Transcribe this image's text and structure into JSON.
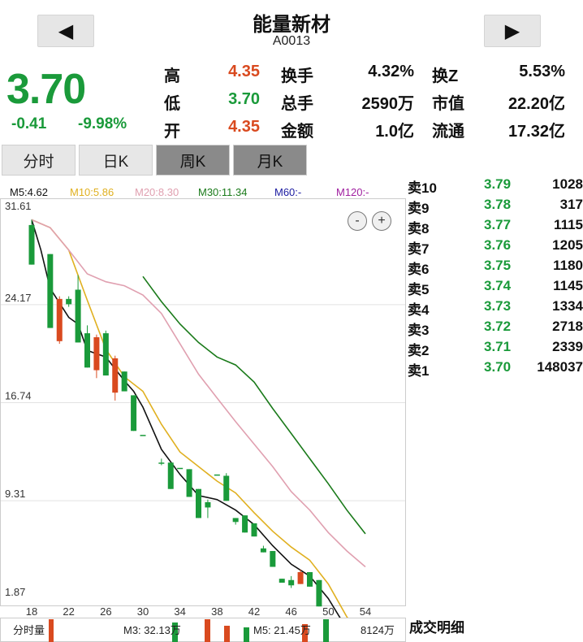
{
  "header": {
    "prev_icon": "left-triangle-icon",
    "next_icon": "right-triangle-icon",
    "name": "能量新材",
    "code": "A0013"
  },
  "quote": {
    "price": "3.70",
    "change": "-0.41",
    "change_pct": "-9.98%",
    "stats": [
      {
        "label": "高",
        "value": "4.35",
        "color": "#d94a1f"
      },
      {
        "label": "低",
        "value": "3.70",
        "color": "#1a9a3a"
      },
      {
        "label": "开",
        "value": "4.35",
        "color": "#d94a1f"
      },
      {
        "label": "换手",
        "value": "4.32%",
        "color": "#111111"
      },
      {
        "label": "总手",
        "value": "2590万",
        "color": "#111111"
      },
      {
        "label": "金额",
        "value": "1.0亿",
        "color": "#111111"
      },
      {
        "label": "换Z",
        "value": "5.53%",
        "color": "#111111"
      },
      {
        "label": "市值",
        "value": "22.20亿",
        "color": "#111111"
      },
      {
        "label": "流通",
        "value": "17.32亿",
        "color": "#111111"
      }
    ]
  },
  "tabs": [
    {
      "label": "分时",
      "style": "light"
    },
    {
      "label": "日K",
      "style": "light"
    },
    {
      "label": "周K",
      "style": "dark"
    },
    {
      "label": "月K",
      "style": "dark"
    }
  ],
  "ma_legend": [
    {
      "text": "M5:4.62",
      "color": "#111111"
    },
    {
      "text": "M10:5.86",
      "color": "#e0b020"
    },
    {
      "text": "M20:8.30",
      "color": "#e0a0b0"
    },
    {
      "text": "M30:11.34",
      "color": "#1a7a1a"
    },
    {
      "text": "M60:-",
      "color": "#1a1aa0"
    },
    {
      "text": "M120:-",
      "color": "#a020a0"
    }
  ],
  "zoom": {
    "out_label": "-",
    "in_label": "+"
  },
  "order_book": [
    {
      "label": "卖10",
      "price": "3.79",
      "volume": "1028"
    },
    {
      "label": "卖9",
      "price": "3.78",
      "volume": "317"
    },
    {
      "label": "卖8",
      "price": "3.77",
      "volume": "1115"
    },
    {
      "label": "卖7",
      "price": "3.76",
      "volume": "1205"
    },
    {
      "label": "卖6",
      "price": "3.75",
      "volume": "1180"
    },
    {
      "label": "卖5",
      "price": "3.74",
      "volume": "1145"
    },
    {
      "label": "卖4",
      "price": "3.73",
      "volume": "1334"
    },
    {
      "label": "卖3",
      "price": "3.72",
      "volume": "2718"
    },
    {
      "label": "卖2",
      "price": "3.71",
      "volume": "2339"
    },
    {
      "label": "卖1",
      "price": "3.70",
      "volume": "148037"
    }
  ],
  "volume_bar": {
    "label": "分时量",
    "m3": "M3: 32.13万",
    "m5": "M5: 21.45万",
    "total": "8124万"
  },
  "trade_detail_title": "成交明细",
  "chart_data": {
    "type": "candlestick",
    "ylim": [
      1.87,
      31.61
    ],
    "y_ticks": [
      "31.61",
      "24.17",
      "16.74",
      "9.31",
      "1.87"
    ],
    "x_ticks": [
      "18",
      "22",
      "26",
      "30",
      "34",
      "38",
      "42",
      "46",
      "50",
      "54"
    ],
    "xlim": [
      18,
      55
    ],
    "up_color": "#d94a1f",
    "down_color": "#1a9a3a",
    "candles": [
      {
        "x": 18,
        "o": 30.2,
        "c": 27.2,
        "h": 30.6,
        "l": 27.2
      },
      {
        "x": 20,
        "o": 28.0,
        "c": 22.4,
        "h": 28.0,
        "l": 22.4
      },
      {
        "x": 21,
        "o": 21.4,
        "c": 24.6,
        "h": 24.8,
        "l": 21.2
      },
      {
        "x": 22,
        "o": 24.6,
        "c": 24.2,
        "h": 24.8,
        "l": 24.0
      },
      {
        "x": 23,
        "o": 25.3,
        "c": 21.3,
        "h": 26.4,
        "l": 21.3
      },
      {
        "x": 24,
        "o": 22.0,
        "c": 19.4,
        "h": 22.6,
        "l": 19.4
      },
      {
        "x": 25,
        "o": 19.2,
        "c": 21.7,
        "h": 21.9,
        "l": 18.6
      },
      {
        "x": 26,
        "o": 22.0,
        "c": 18.8,
        "h": 22.2,
        "l": 18.8
      },
      {
        "x": 27,
        "o": 17.5,
        "c": 20.1,
        "h": 20.3,
        "l": 16.9
      },
      {
        "x": 28,
        "o": 19.1,
        "c": 17.6,
        "h": 19.1,
        "l": 17.6
      },
      {
        "x": 29,
        "o": 17.3,
        "c": 14.6,
        "h": 17.3,
        "l": 14.6
      },
      {
        "x": 30,
        "o": 14.3,
        "c": 14.3,
        "h": 14.3,
        "l": 14.3
      },
      {
        "x": 32,
        "o": 12.2,
        "c": 12.2,
        "h": 12.5,
        "l": 12.0
      },
      {
        "x": 33,
        "o": 12.2,
        "c": 10.2,
        "h": 12.2,
        "l": 10.2
      },
      {
        "x": 34,
        "o": 11.8,
        "c": 11.8,
        "h": 11.8,
        "l": 11.8
      },
      {
        "x": 35,
        "o": 11.7,
        "c": 9.6,
        "h": 11.7,
        "l": 9.6
      },
      {
        "x": 36,
        "o": 10.2,
        "c": 8.0,
        "h": 10.2,
        "l": 8.0
      },
      {
        "x": 37,
        "o": 9.2,
        "c": 8.8,
        "h": 9.4,
        "l": 8.0
      },
      {
        "x": 38,
        "o": 11.3,
        "c": 11.3,
        "h": 11.3,
        "l": 11.3
      },
      {
        "x": 39,
        "o": 11.2,
        "c": 9.3,
        "h": 11.4,
        "l": 9.3
      },
      {
        "x": 40,
        "o": 8.0,
        "c": 7.7,
        "h": 8.0,
        "l": 7.5
      },
      {
        "x": 41,
        "o": 8.2,
        "c": 6.9,
        "h": 8.2,
        "l": 6.9
      },
      {
        "x": 42,
        "o": 7.6,
        "c": 6.6,
        "h": 7.6,
        "l": 6.6
      },
      {
        "x": 43,
        "o": 5.7,
        "c": 5.4,
        "h": 5.9,
        "l": 5.4
      },
      {
        "x": 44,
        "o": 5.5,
        "c": 4.3,
        "h": 5.5,
        "l": 4.3
      },
      {
        "x": 45,
        "o": 3.4,
        "c": 3.1,
        "h": 3.4,
        "l": 3.1
      },
      {
        "x": 46,
        "o": 3.3,
        "c": 2.9,
        "h": 3.6,
        "l": 2.7
      },
      {
        "x": 47,
        "o": 3.0,
        "c": 3.9,
        "h": 4.1,
        "l": 3.0
      },
      {
        "x": 48,
        "o": 3.9,
        "c": 2.8,
        "h": 3.9,
        "l": 2.8
      },
      {
        "x": 49,
        "o": 3.3,
        "c": 1.3,
        "h": 3.3,
        "l": 1.3
      },
      {
        "x": 50,
        "o": 0.2,
        "c": 0.2,
        "h": 0.2,
        "l": 0.2
      },
      {
        "x": 51,
        "o": -0.8,
        "c": -0.8,
        "h": -0.8,
        "l": -0.8
      },
      {
        "x": 52,
        "o": -1.6,
        "c": -1.6,
        "h": -1.6,
        "l": -1.6
      },
      {
        "x": 53,
        "o": -2.5,
        "c": -2.5,
        "h": -2.3,
        "l": -2.7
      },
      {
        "x": 54,
        "o": -2.7,
        "c": -3.7,
        "h": -2.7,
        "l": -3.7
      }
    ],
    "series": [
      {
        "name": "M5",
        "color": "#111111",
        "x": [
          18,
          19,
          20,
          22,
          23,
          24,
          26,
          28,
          29,
          30,
          32,
          34,
          36,
          38,
          40,
          42,
          44,
          46,
          48,
          50,
          52,
          54
        ],
        "y": [
          30.6,
          28.3,
          25.4,
          23.2,
          22.7,
          20.7,
          20.2,
          18.4,
          17.6,
          16.4,
          13.2,
          11.3,
          9.7,
          9.4,
          8.6,
          7.5,
          5.9,
          4.5,
          3.6,
          1.9,
          -0.4,
          -1.9
        ]
      },
      {
        "name": "M10",
        "color": "#e0b020",
        "x": [
          18,
          20,
          22,
          24,
          26,
          28,
          30,
          32,
          34,
          36,
          38,
          40,
          42,
          44,
          46,
          48,
          50,
          52,
          54
        ],
        "y": [
          30.6,
          30.0,
          28.3,
          24.5,
          20.8,
          18.7,
          17.6,
          15.1,
          13.0,
          11.9,
          10.8,
          9.9,
          8.4,
          7.0,
          5.8,
          4.8,
          3.0,
          0.5,
          -1.1
        ]
      },
      {
        "name": "M20",
        "color": "#e0a0b0",
        "x": [
          18,
          20,
          22,
          24,
          26,
          28,
          30,
          32,
          34,
          36,
          38,
          40,
          42,
          44,
          46,
          48,
          50,
          52,
          54
        ],
        "y": [
          30.6,
          30.0,
          28.3,
          26.5,
          25.9,
          25.6,
          24.9,
          23.5,
          21.2,
          18.9,
          17.1,
          15.3,
          13.6,
          11.9,
          10.0,
          8.6,
          6.9,
          5.5,
          4.3
        ]
      },
      {
        "name": "M30",
        "color": "#1a7a1a",
        "x": [
          30,
          32,
          34,
          36,
          38,
          40,
          42,
          44,
          46,
          48,
          50,
          52,
          54
        ],
        "y": [
          26.3,
          24.4,
          22.7,
          21.3,
          20.2,
          19.6,
          18.3,
          16.3,
          14.4,
          12.5,
          10.6,
          8.6,
          6.8
        ]
      }
    ]
  }
}
